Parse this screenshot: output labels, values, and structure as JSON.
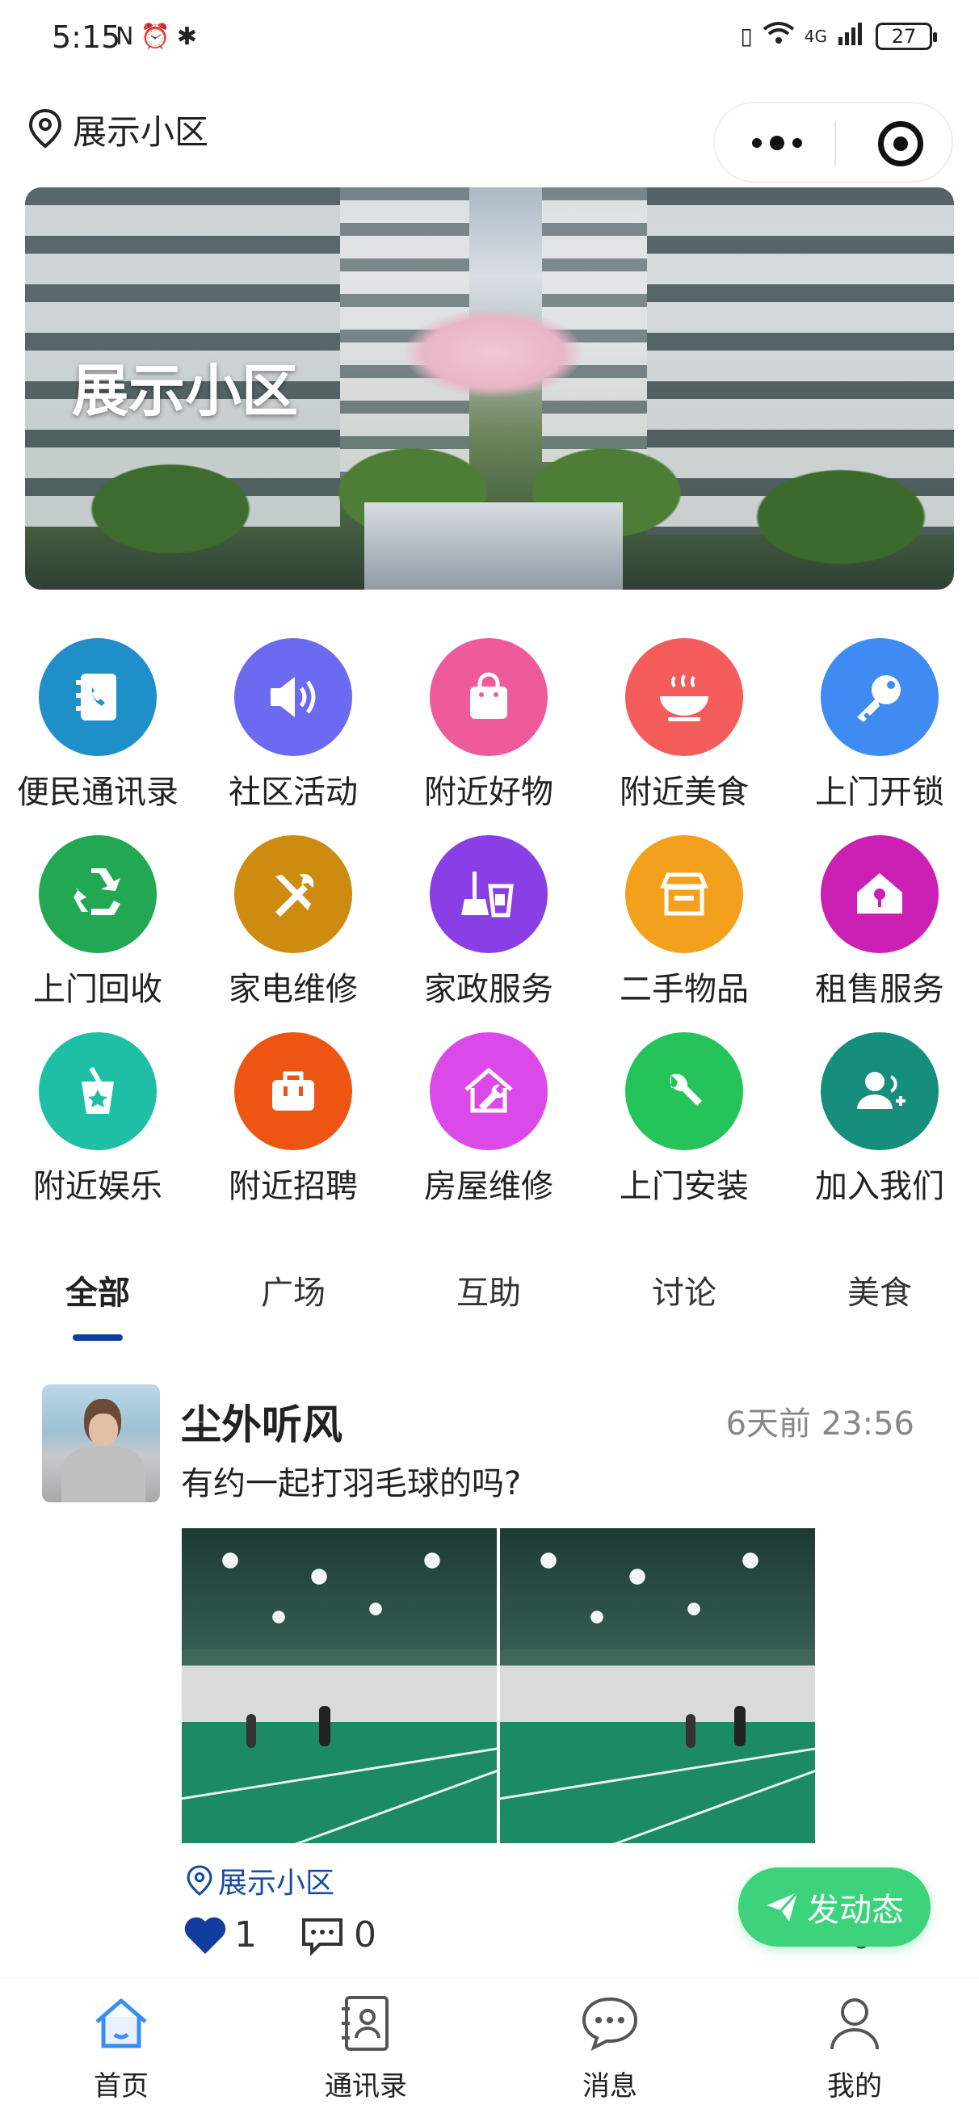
{
  "status_bar": {
    "time": "5:15",
    "network": "4G",
    "battery": "27"
  },
  "header": {
    "location": "展示小区"
  },
  "banner": {
    "title": "展示小区"
  },
  "services": [
    {
      "label": "便民通讯录",
      "icon": "phone-book-icon",
      "color": "#1e8fc8"
    },
    {
      "label": "社区活动",
      "icon": "speaker-icon",
      "color": "#6b6af0"
    },
    {
      "label": "附近好物",
      "icon": "shopping-bag-icon",
      "color": "#ef5a9c"
    },
    {
      "label": "附近美食",
      "icon": "food-bowl-icon",
      "color": "#f45b5b"
    },
    {
      "label": "上门开锁",
      "icon": "key-icon",
      "color": "#3f8bf2"
    },
    {
      "label": "上门回收",
      "icon": "recycle-icon",
      "color": "#22a853"
    },
    {
      "label": "家电维修",
      "icon": "tools-icon",
      "color": "#cd8b10"
    },
    {
      "label": "家政服务",
      "icon": "broom-bucket-icon",
      "color": "#8a3fe6"
    },
    {
      "label": "二手物品",
      "icon": "store-icon",
      "color": "#f3a01c"
    },
    {
      "label": "租售服务",
      "icon": "house-key-icon",
      "color": "#cc1fb3"
    },
    {
      "label": "附近娱乐",
      "icon": "gift-bucket-icon",
      "color": "#1fbfa5"
    },
    {
      "label": "附近招聘",
      "icon": "briefcase-icon",
      "color": "#ef5512"
    },
    {
      "label": "房屋维修",
      "icon": "house-wrench-icon",
      "color": "#db4ae8"
    },
    {
      "label": "上门安装",
      "icon": "wrench-icon",
      "color": "#25c45b"
    },
    {
      "label": "加入我们",
      "icon": "add-user-icon",
      "color": "#168e7c"
    }
  ],
  "tabs": [
    {
      "label": "全部",
      "active": true
    },
    {
      "label": "广场",
      "active": false
    },
    {
      "label": "互助",
      "active": false
    },
    {
      "label": "讨论",
      "active": false
    },
    {
      "label": "美食",
      "active": false
    }
  ],
  "post": {
    "author": "尘外听风",
    "time": "6天前 23:56",
    "text": "有约一起打羽毛球的吗?",
    "location": "展示小区",
    "likes": "1",
    "comments": "0",
    "corner_count": "0"
  },
  "fab": {
    "label": "发动态"
  },
  "bottom_nav": [
    {
      "label": "首页",
      "icon": "home-icon",
      "active": true
    },
    {
      "label": "通讯录",
      "icon": "contacts-icon",
      "active": false
    },
    {
      "label": "消息",
      "icon": "message-icon",
      "active": false
    },
    {
      "label": "我的",
      "icon": "profile-icon",
      "active": false
    }
  ],
  "colors": {
    "accent_blue": "#0d3fa0",
    "home_active": "#3a8ef0",
    "fab_green": "#3cd37c",
    "location_blue": "#1a4ba0",
    "like_heart": "#123c9e"
  }
}
